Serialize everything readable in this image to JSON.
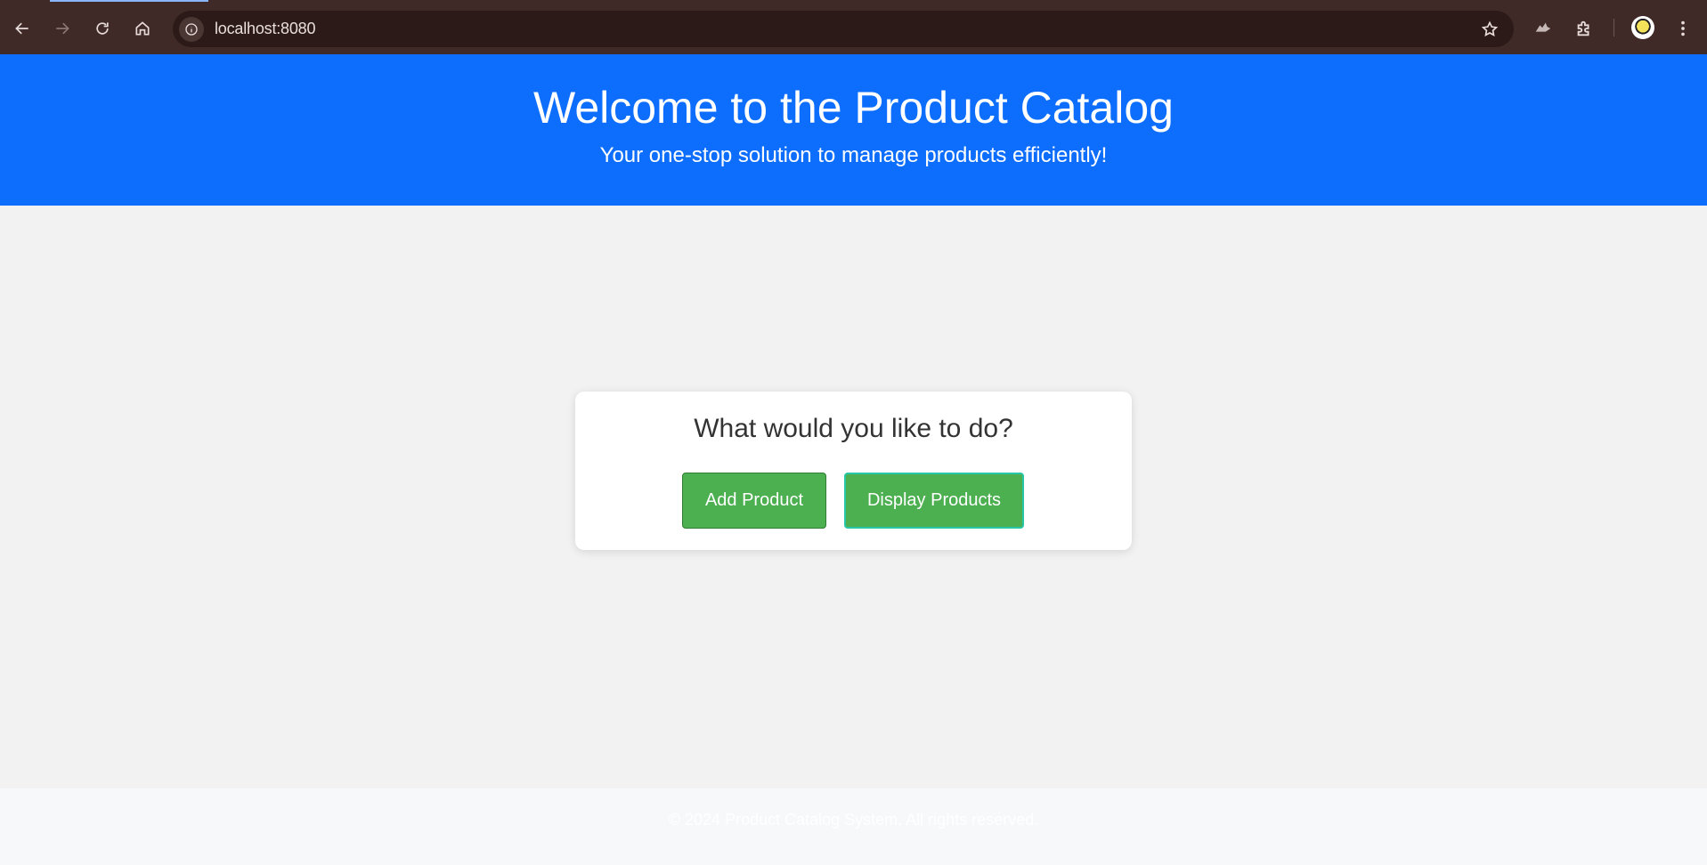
{
  "browser": {
    "url": "localhost:8080",
    "icons": {
      "back": "arrow-left-icon",
      "forward": "arrow-right-icon",
      "reload": "reload-icon",
      "home": "home-icon",
      "site_info": "info-icon",
      "bookmark": "star-icon",
      "extension_1": "wolf-extension-icon",
      "extensions": "puzzle-icon",
      "profile": "avatar",
      "menu": "kebab-menu-icon"
    }
  },
  "header": {
    "title": "Welcome to the Product Catalog",
    "subtitle": "Your one-stop solution to manage products efficiently!"
  },
  "card": {
    "question": "What would you like to do?",
    "add_button_label": "Add Product",
    "display_button_label": "Display Products"
  },
  "footer": {
    "text": "© 2024 Product Catalog System. All rights reserved."
  },
  "colors": {
    "header_bg": "#0d6efd",
    "button_bg": "#4caf50",
    "page_bg": "#f2f2f2",
    "browser_chrome": "#3f2a27"
  }
}
